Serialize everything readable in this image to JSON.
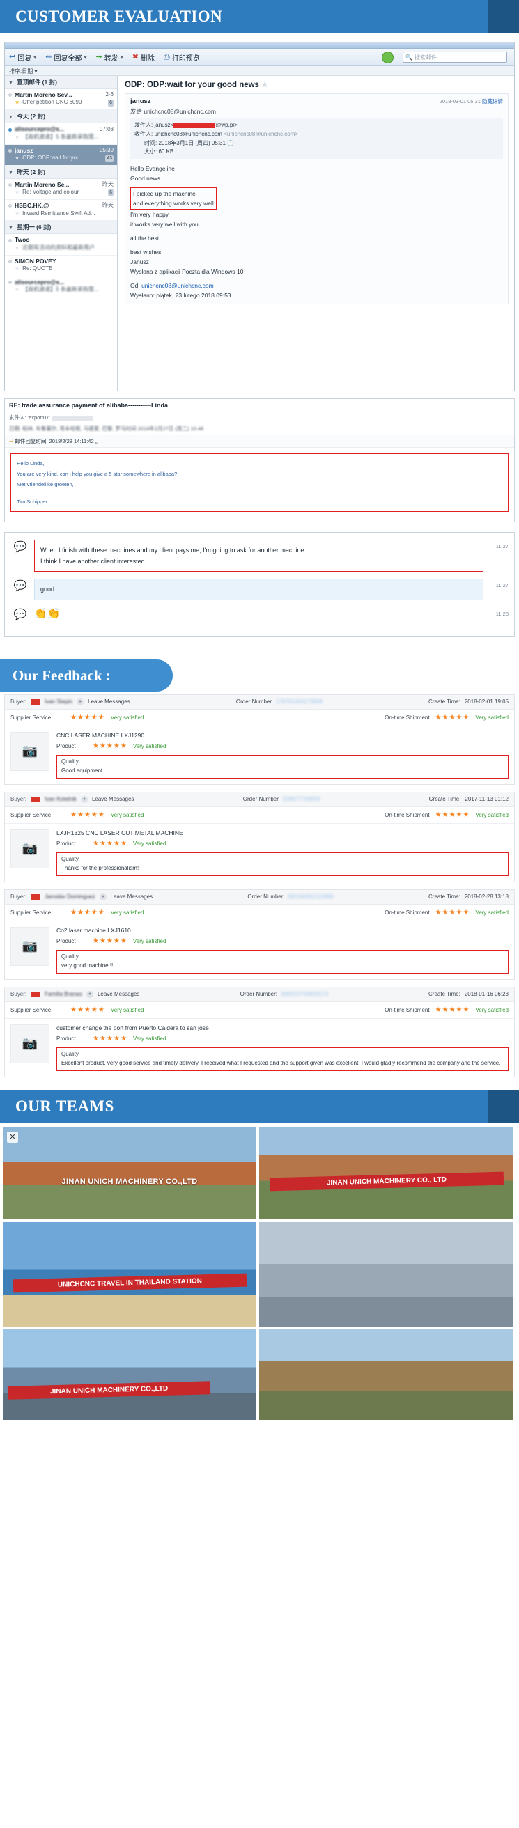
{
  "sections": {
    "customer_evaluation_title": "CUSTOMER EVALUATION",
    "feedback_title": "Our Feedback :",
    "teams_title": "OUR TEAMS"
  },
  "mail": {
    "toolbar": [
      {
        "label": "回复",
        "icon": "reply-icon",
        "caret": "▾"
      },
      {
        "label": "回复全部",
        "icon": "reply-all-icon",
        "caret": "▾"
      },
      {
        "label": "转发",
        "icon": "forward-icon",
        "caret": "▾"
      },
      {
        "label": "删除",
        "icon": "delete-icon",
        "caret": ""
      },
      {
        "label": "打印预览",
        "icon": "print-icon",
        "caret": ""
      }
    ],
    "search_placeholder": "搜索邮件",
    "sort_label": "排序:日期",
    "list": [
      {
        "group": "置顶邮件 (1 封)",
        "items": [
          {
            "from": "Martin Moreno Sev...",
            "subject": "Offer petition CNC 6090",
            "date": "2-6",
            "badge": "6",
            "star": "filled",
            "dot": "gray",
            "selected": false,
            "redacted": false
          }
        ]
      },
      {
        "group": "今天 (2 封)",
        "items": [
          {
            "from": "alisourcepro@s...",
            "subject": "【商机速递】5 条最新采购需...",
            "date": "07:03",
            "badge": "",
            "star": "gray",
            "dot": "blue",
            "selected": false,
            "redacted": true
          },
          {
            "from": "janusz",
            "subject": "ODP: ODP:wait for you...",
            "date": "05:30",
            "badge": "43",
            "star": "gray",
            "dot": "gray",
            "selected": true,
            "redacted": false
          }
        ]
      },
      {
        "group": "昨天 (2 封)",
        "items": [
          {
            "from": "Martin Moreno Se...",
            "subject": "Re: Voltage and colour",
            "date": "昨天",
            "badge": "6",
            "star": "gray",
            "dot": "gray",
            "selected": false,
            "redacted": true
          },
          {
            "from": "HSBC.HK.@",
            "subject": "Inward Remittance Swift Ad...",
            "date": "昨天",
            "badge": "",
            "star": "gray",
            "dot": "gray",
            "selected": false,
            "redacted": false
          }
        ]
      },
      {
        "group": "星期一 (6 封)",
        "items": [
          {
            "from": "Twoo",
            "subject": "近期有活动的资料和最新用户",
            "date": "",
            "badge": "",
            "star": "gray",
            "dot": "gray",
            "selected": false,
            "redacted": false
          },
          {
            "from": "SIMON POVEY",
            "subject": "Re: QUOTE",
            "date": "",
            "badge": "",
            "star": "gray",
            "dot": "gray",
            "selected": false,
            "redacted": false
          },
          {
            "from": "alisourcepro@s...",
            "subject": "【商机速递】5 条最新采购需...",
            "date": "",
            "badge": "",
            "star": "gray",
            "dot": "gray",
            "selected": false,
            "redacted": true
          }
        ]
      }
    ],
    "reading": {
      "subject": "ODP: ODP:wait for your good news",
      "sender": "janusz",
      "to_line_label": "发给",
      "to_line_value": "unichcnc08@unichcnc.com",
      "headers": [
        {
          "label": "发件人:",
          "value": "janusz<",
          "redacted": true,
          "tail": "@wp.pl>"
        },
        {
          "label": "收件人:",
          "value": "unichcnc08@unichcnc.com",
          "muted": "<unichcnc08@unichcnc.com>"
        },
        {
          "label": "时间:",
          "value": "2018年3月1日 (周四) 05:31"
        },
        {
          "label": "大小:",
          "value": "60 KB"
        }
      ],
      "body": {
        "greeting": "Hello Evangeline",
        "line2": "Good news",
        "highlight_line1": "I picked up the machine",
        "highlight_line2": "and everything works very well",
        "line3": "I'm very happy",
        "line4": "it works very well with you",
        "line5": "all the best",
        "line6": "best wishes",
        "line7": "Janusz",
        "line8": "Wysłana z aplikacji Poczta dla Windows 10",
        "od_label": "Od:",
        "od_value": "unichcnc08@unichcnc.com",
        "wyslano": "Wysłano: piątek, 23 lutego 2018 09:53"
      },
      "timestamp_right": "2018-03-01 05:31",
      "hide_details": "隐藏详情"
    }
  },
  "trade_assurance": {
    "title": "RE: trade assurance payment of alibaba-----------Linda",
    "from_label": "发件人:",
    "from_value": "'export07'",
    "date_line": "日期: 柏林, 布鲁塞尔, 哥本哈根, 马德里, 巴黎, 罗马时间 2018年2月27日 (周二) 10:48",
    "reply_time": "邮件回复时间: 2018/2/28 14:11:42 。",
    "quote": [
      "Hello Linda,",
      "You are very kind, can i help you give a 5 star somewhere in alibaba?",
      "Met vriendelijke groeten,",
      "",
      "Tim Schipper"
    ]
  },
  "chat": [
    {
      "avatar": "chat-avatar-icon",
      "lines": [
        "When I finish with these machines and my client pays me, I'm going to ask for another machine.",
        "I think I have another client interested."
      ],
      "time": "11:27",
      "style": "highlight"
    },
    {
      "avatar": "chat-avatar-icon",
      "lines": [
        "good"
      ],
      "time": "11:27",
      "style": "plain"
    },
    {
      "avatar": "chat-avatar-icon",
      "lines": [
        "👏👏"
      ],
      "time": "11:28",
      "style": "emoji"
    }
  ],
  "feedback": {
    "labels": {
      "buyer": "Buyer:",
      "leave_messages": "Leave Messages",
      "order_number": "Order Number",
      "order_number_colon": "Order Number:",
      "create_time": "Create Time:",
      "supplier_service": "Supplier Service",
      "on_time_shipment": "On-time Shipment",
      "product": "Product",
      "quality": "Quality",
      "very_satisfied": "Very satisfied",
      "stars": "★★★★★"
    },
    "cards": [
      {
        "buyer_name": "Ivan Stepin",
        "order_number": "178761400173808",
        "create_time": "2018-02-01 19:05",
        "supplier_service": "Very satisfied",
        "on_time_shipment": "Very satisfied",
        "product_title": "CNC LASER MACHINE LXJ1290",
        "product_rating": "Very satisfied",
        "quality_text": "Good equipment"
      },
      {
        "buyer_name": "Ivan Kotelnik",
        "order_number": "506677709059",
        "create_time": "2017-11-13 01:12",
        "supplier_service": "Very satisfied",
        "on_time_shipment": "Very satisfied",
        "product_title": "LXJH1325 CNC LASER CUT METAL MACHINE",
        "product_rating": "Very satisfied",
        "quality_text": "Thanks for the professionalism!"
      },
      {
        "buyer_name": "Jaroslav Dominguez",
        "order_number": "390160652110889",
        "create_time": "2018-02-28 13:18",
        "supplier_service": "Very satisfied",
        "on_time_shipment": "Very satisfied",
        "product_title": "Co2 laser machine LXJ1610",
        "product_rating": "Very satisfied",
        "quality_text": "very good machine !!!"
      },
      {
        "buyer_name": "Familia Branao",
        "order_number": "866013756803173",
        "create_time": "2018-01-16 06:23",
        "supplier_service": "Very satisfied",
        "on_time_shipment": "Very satisfied",
        "product_title": "customer change the port from Puerto Caldera to san jose",
        "product_rating": "Very satisfied",
        "quality_text": "Excellent product, very good service and timely delivery. I received what I requested and the support given was excellent. I would gladly recommend the company and the service."
      }
    ]
  },
  "teams": {
    "photos": [
      {
        "caption": "JINAN UNICH MACHINERY CO.,LTD",
        "caption_style": "white",
        "alt": "team-photo-temple-gate"
      },
      {
        "caption": "JINAN UNICH MACHINERY CO., LTD",
        "caption_style": "red-banner",
        "alt": "team-photo-red-banner-group"
      },
      {
        "caption": "UNICHCNC TRAVEL IN THAILAND STATION",
        "caption_style": "red-banner",
        "alt": "team-photo-beach-banner"
      },
      {
        "caption": "",
        "caption_style": "none",
        "alt": "team-photo-courtyard-lineup"
      },
      {
        "caption": "JINAN UNICH MACHINERY CO.,LTD",
        "caption_style": "red-banner-left",
        "alt": "team-photo-city-skyline"
      },
      {
        "caption": "",
        "caption_style": "none",
        "alt": "team-photo-thai-temple"
      }
    ]
  },
  "colors": {
    "banner_blue": "#2e7cbe",
    "banner_dark": "#1d5584",
    "pill_blue": "#3f8ed0",
    "star_orange": "#f5821f",
    "satisfied_green": "#3a9b3a",
    "highlight_red": "#e02020"
  }
}
